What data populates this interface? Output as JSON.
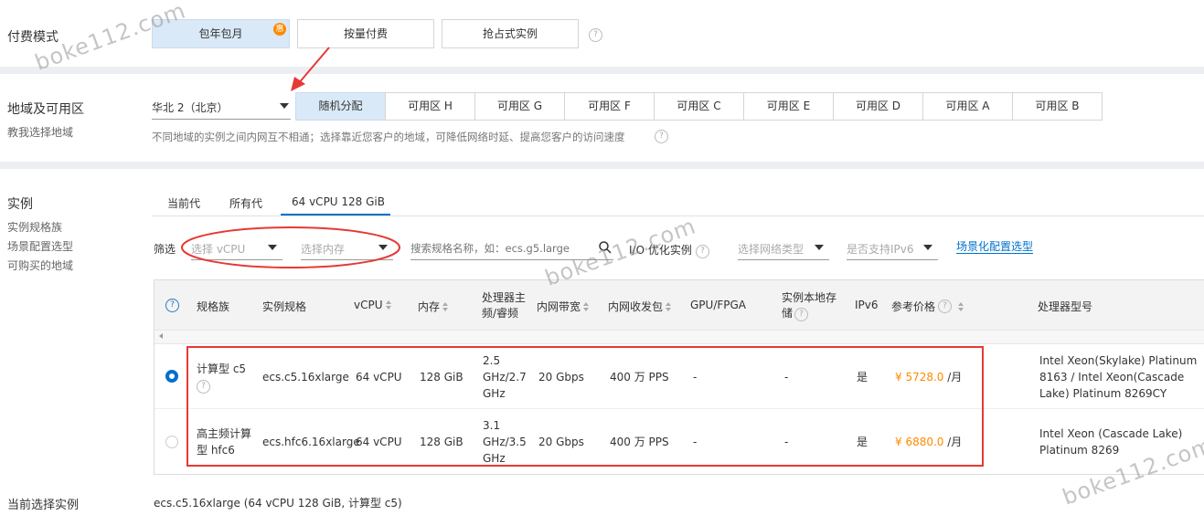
{
  "billing": {
    "label": "付费模式",
    "options": [
      "包年包月",
      "按量付费",
      "抢占式实例"
    ],
    "selected_badge": "惠"
  },
  "region": {
    "label": "地域及可用区",
    "sublabel": "教我选择地域",
    "selected": "华北 2（北京）",
    "zones": [
      "随机分配",
      "可用区 H",
      "可用区 G",
      "可用区 F",
      "可用区 C",
      "可用区 E",
      "可用区 D",
      "可用区 A",
      "可用区 B"
    ],
    "hint": "不同地域的实例之间内网互不相通；选择靠近您客户的地域，可降低网络时延、提高您客户的访问速度"
  },
  "instance": {
    "label": "实例",
    "side_links": [
      "实例规格族",
      "场景配置选型",
      "可购买的地域"
    ],
    "tabs": [
      "当前代",
      "所有代",
      "64 vCPU 128 GiB"
    ],
    "filter_label": "筛选",
    "filters": {
      "vcpu_placeholder": "选择 vCPU",
      "memory_placeholder": "选择内存",
      "search_placeholder": "搜索规格名称，如：ecs.g5.large",
      "io_label": "I/O 优化实例",
      "network_placeholder": "选择网络类型",
      "ipv6_placeholder": "是否支持IPv6",
      "scenario_link": "场景化配置选型"
    },
    "columns": [
      "规格族",
      "实例规格",
      "vCPU",
      "内存",
      "处理器主频/睿频",
      "内网带宽",
      "内网收发包",
      "GPU/FPGA",
      "实例本地存储",
      "IPv6",
      "参考价格",
      "处理器型号"
    ],
    "rows": [
      {
        "family": "计算型 c5",
        "spec": "ecs.c5.16xlarge",
        "vcpu": "64 vCPU",
        "memory": "128 GiB",
        "freq": "2.5 GHz/2.7 GHz",
        "bandwidth": "20 Gbps",
        "pps": "400 万 PPS",
        "gpu": "-",
        "storage": "-",
        "ipv6": "是",
        "price": "¥ 5728.0",
        "price_unit": " /月",
        "cpu": "Intel Xeon(Skylake) Platinum 8163 / Intel Xeon(Cascade Lake) Platinum 8269CY",
        "selected": true
      },
      {
        "family": "高主频计算型 hfc6",
        "spec": "ecs.hfc6.16xlarge",
        "vcpu": "64 vCPU",
        "memory": "128 GiB",
        "freq": "3.1 GHz/3.5 GHz",
        "bandwidth": "20 Gbps",
        "pps": "400 万 PPS",
        "gpu": "-",
        "storage": "-",
        "ipv6": "是",
        "price": "¥ 6880.0",
        "price_unit": " /月",
        "cpu": "Intel Xeon (Cascade Lake) Platinum 8269",
        "selected": false
      }
    ]
  },
  "current": {
    "label": "当前选择实例",
    "value": "ecs.c5.16xlarge (64 vCPU 128 GiB, 计算型 c5)"
  },
  "watermark": "boke112.com",
  "colors": {
    "accent": "#0070cc",
    "selected_bg": "#d9e9f7",
    "price": "#ff8a00",
    "annotation": "#e53935"
  }
}
